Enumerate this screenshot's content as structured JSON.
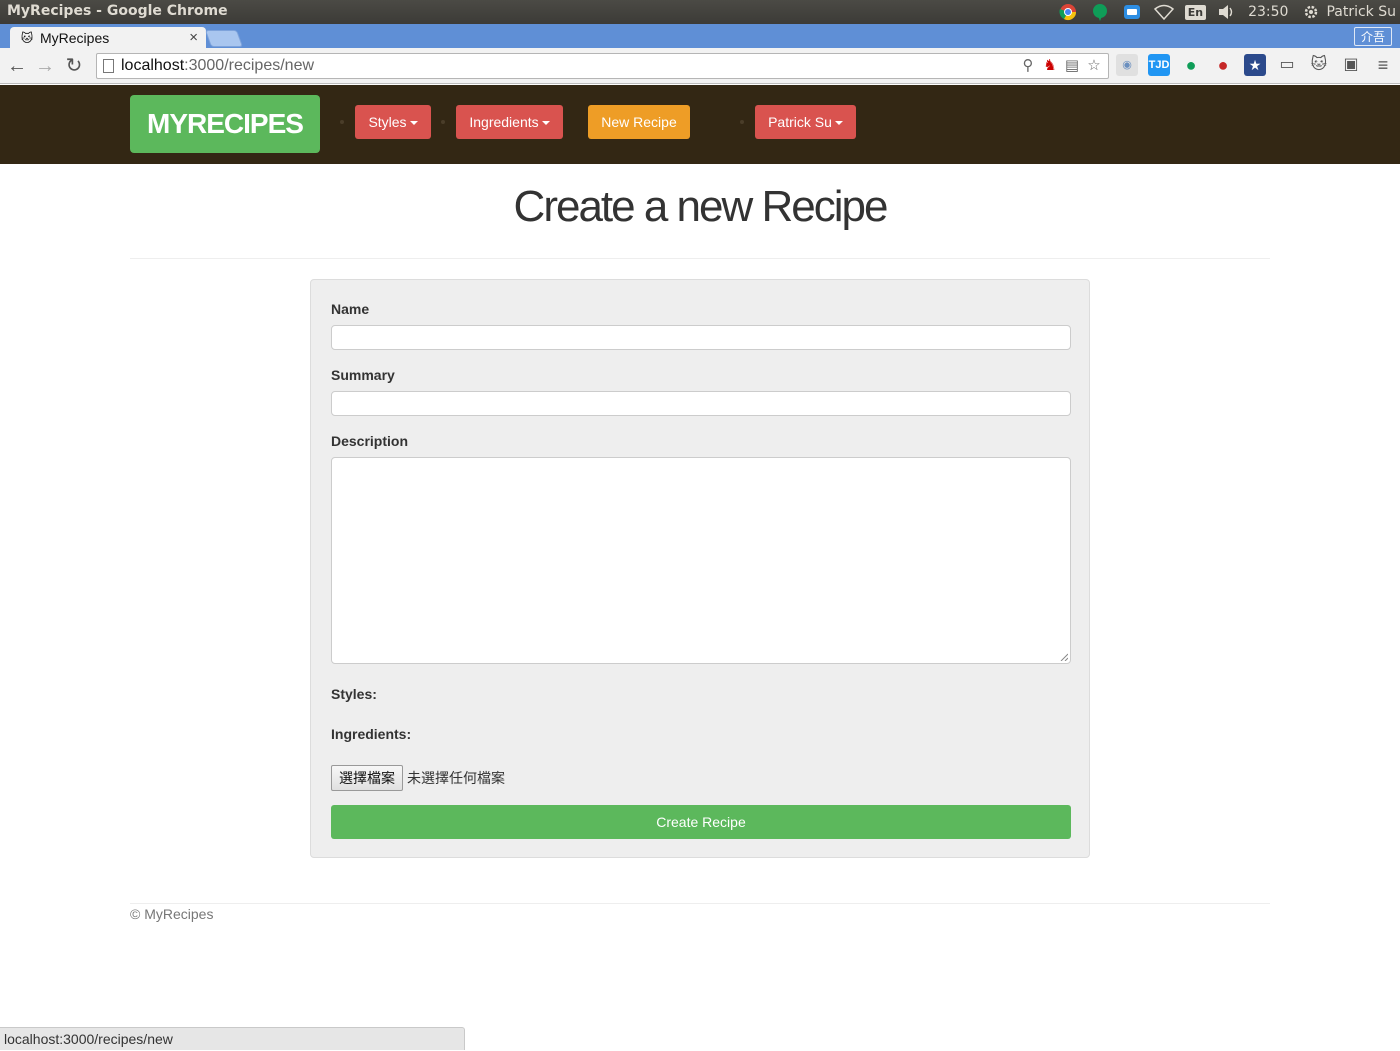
{
  "os": {
    "window_title": "MyRecipes - Google Chrome",
    "lang": "En",
    "clock": "23:50",
    "user": "Patrick Su"
  },
  "browser": {
    "tab_title": "MyRecipes",
    "tab_close": "×",
    "ime_label": "介吾",
    "url_host": "localhost",
    "url_path": ":3000/recipes/new",
    "ext_tjd": "TJD",
    "status_url": "localhost:3000/recipes/new"
  },
  "navbar": {
    "brand": "MYRECIPES",
    "styles": "Styles",
    "ingredients": "Ingredients",
    "new_recipe": "New Recipe",
    "user_menu": "Patrick Su"
  },
  "page": {
    "title": "Create a new Recipe"
  },
  "form": {
    "name_label": "Name",
    "summary_label": "Summary",
    "description_label": "Description",
    "styles_label": "Styles:",
    "ingredients_label": "Ingredients:",
    "file_button": "選擇檔案",
    "file_status": "未選擇任何檔案",
    "submit": "Create Recipe"
  },
  "footer": {
    "text": "© MyRecipes"
  },
  "colors": {
    "navbar_bg": "#332714",
    "brand_green": "#5cb85c",
    "danger_red": "#d9534f",
    "warning_orange": "#ee9d26"
  }
}
